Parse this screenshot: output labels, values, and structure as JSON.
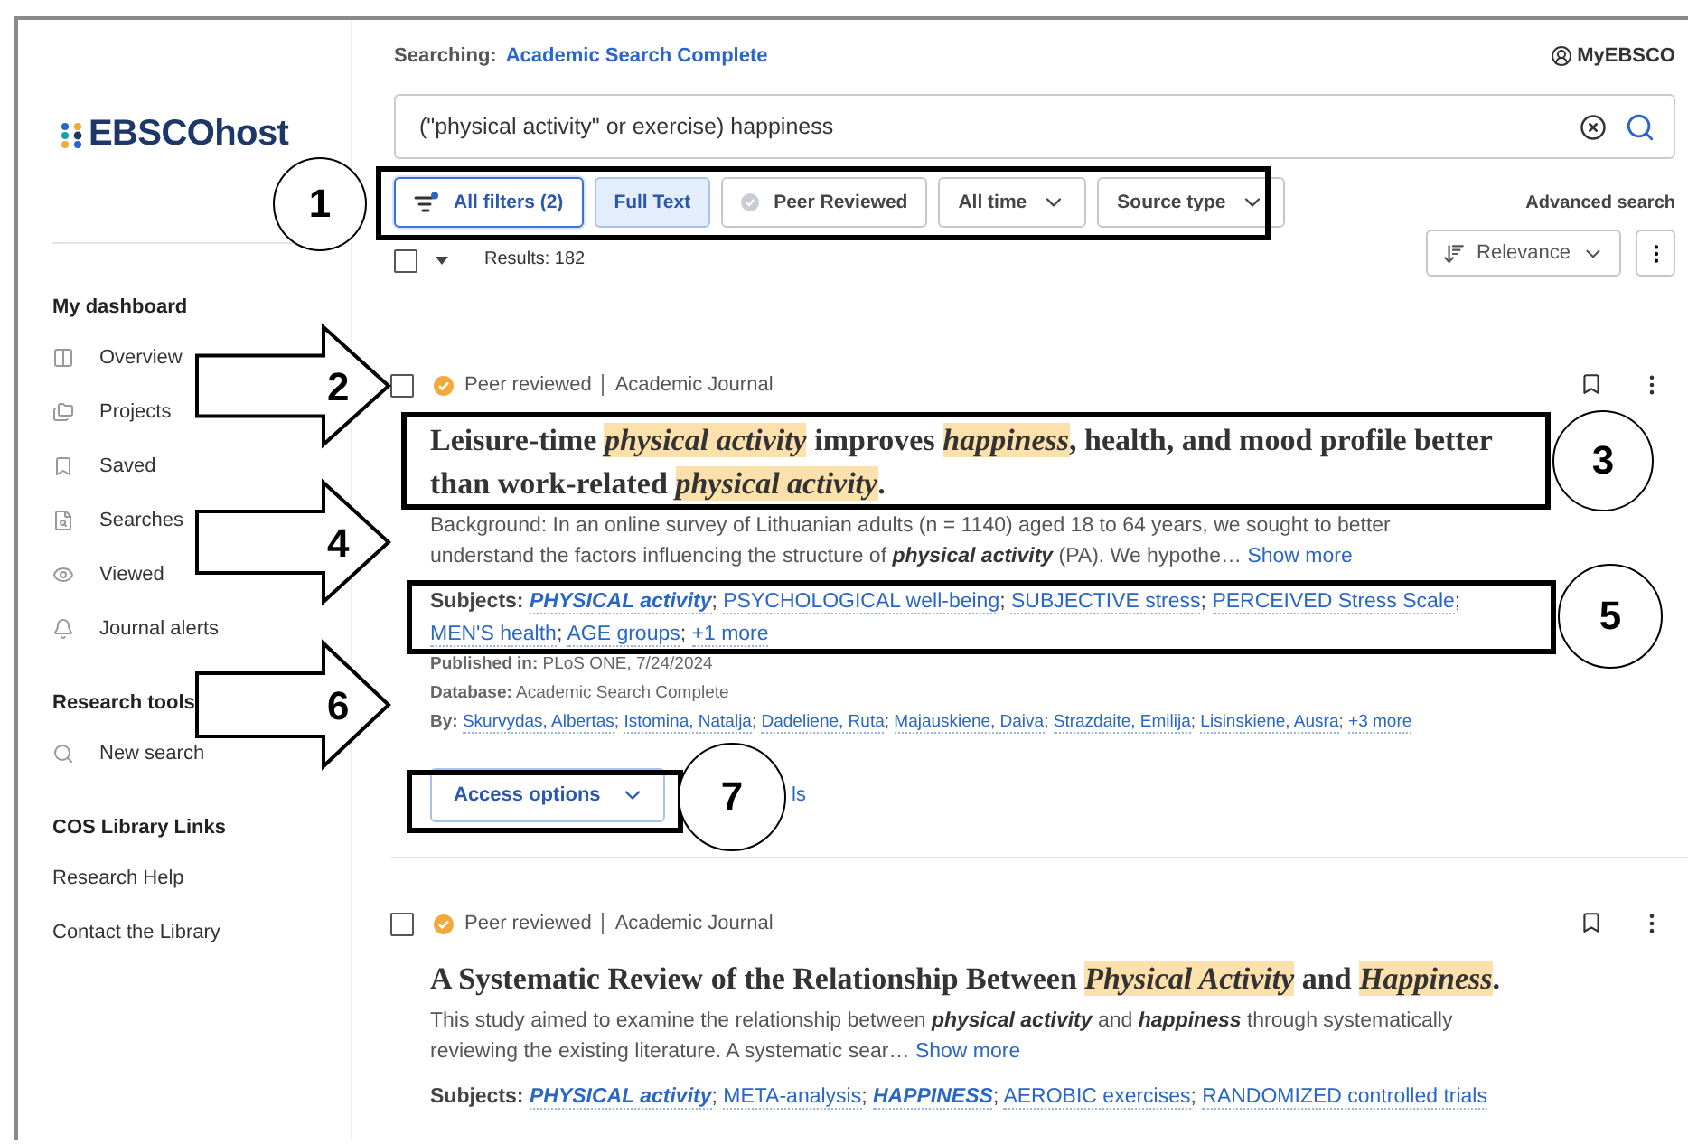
{
  "logo": {
    "text": "EBSCOhost"
  },
  "sidebar": {
    "sections": [
      {
        "heading": "My dashboard",
        "items": [
          {
            "label": "Overview"
          },
          {
            "label": "Projects"
          },
          {
            "label": "Saved"
          },
          {
            "label": "Searches"
          },
          {
            "label": "Viewed"
          },
          {
            "label": "Journal alerts"
          }
        ]
      },
      {
        "heading": "Research tools",
        "items": [
          {
            "label": "New search"
          }
        ]
      },
      {
        "heading": "COS Library Links",
        "items": [
          {
            "label": "Research Help"
          },
          {
            "label": "Contact the Library"
          }
        ]
      }
    ]
  },
  "header": {
    "searching_label": "Searching:",
    "database": "Academic Search Complete",
    "account": "MyEBSCO"
  },
  "search": {
    "value": "(\"physical activity\" or exercise) happiness"
  },
  "filters": [
    {
      "label": "All filters (2)",
      "kind": "filters",
      "selected": true
    },
    {
      "label": "Full Text",
      "kind": "toggle",
      "selected": true
    },
    {
      "label": "Peer Reviewed",
      "kind": "toggle",
      "selected": false
    },
    {
      "label": "All time",
      "kind": "dropdown",
      "selected": false
    },
    {
      "label": "Source type",
      "kind": "dropdown",
      "selected": false
    }
  ],
  "advanced_search": "Advanced search",
  "select_all": {
    "checked": false
  },
  "results_count": "Results: 182",
  "sort": "Relevance",
  "separator": ";",
  "results": [
    {
      "checked": false,
      "badge": "Peer reviewed",
      "type": "Academic Journal",
      "title": "Leisure-time *physical activity* improves *happiness*, health, and mood profile better than work-related *physical activity*.",
      "abstract": "Background: In an online survey of Lithuanian adults (n = 1140) aged 18 to 64 years, we sought to better understand the factors influencing the structure of **physical activity** (PA). We hypothe…",
      "show_more": "Show more",
      "subjects_label": "Subjects:",
      "subjects": [
        {
          "text": "PHYSICAL activity",
          "matched": true
        },
        {
          "text": "PSYCHOLOGICAL well-being",
          "matched": false
        },
        {
          "text": "SUBJECTIVE stress",
          "matched": false
        },
        {
          "text": "PERCEIVED Stress Scale",
          "matched": false
        },
        {
          "text": "MEN'S health",
          "matched": false
        },
        {
          "text": "AGE groups",
          "matched": false
        }
      ],
      "subjects_more": "+1 more",
      "published_label": "Published in:",
      "published": "PLoS ONE, 7/24/2024",
      "database_label": "Database:",
      "database": "Academic Search Complete",
      "authors_label": "By:",
      "authors": [
        "Skurvydas, Albertas",
        "Istomina, Natalja",
        "Dadeliene, Ruta",
        "Majauskiene, Daiva",
        "Strazdaite, Emilija",
        "Lisinskiene, Ausra"
      ],
      "authors_more": "+3 more",
      "access": "Access options",
      "details_fragment": "ls"
    },
    {
      "checked": false,
      "badge": "Peer reviewed",
      "type": "Academic Journal",
      "title": "A Systematic Review of the Relationship Between *Physical Activity* and *Happiness*.",
      "abstract": "This study aimed to examine the relationship between **physical activity** and **happiness** through systematically reviewing the existing literature. A systematic sear…",
      "show_more": "Show more",
      "subjects_label": "Subjects:",
      "subjects": [
        {
          "text": "PHYSICAL activity",
          "matched": true
        },
        {
          "text": "META-analysis",
          "matched": false
        },
        {
          "text": "HAPPINESS",
          "matched": true
        },
        {
          "text": "AEROBIC exercises",
          "matched": false
        },
        {
          "text": "RANDOMIZED controlled trials",
          "matched": false
        }
      ]
    }
  ],
  "annotations": [
    {
      "kind": "box-circle",
      "number": "1"
    },
    {
      "kind": "arrow",
      "number": "2"
    },
    {
      "kind": "box-circle",
      "number": "3"
    },
    {
      "kind": "arrow",
      "number": "4"
    },
    {
      "kind": "box-circle",
      "number": "5"
    },
    {
      "kind": "arrow",
      "number": "6"
    },
    {
      "kind": "box-circle",
      "number": "7"
    }
  ]
}
